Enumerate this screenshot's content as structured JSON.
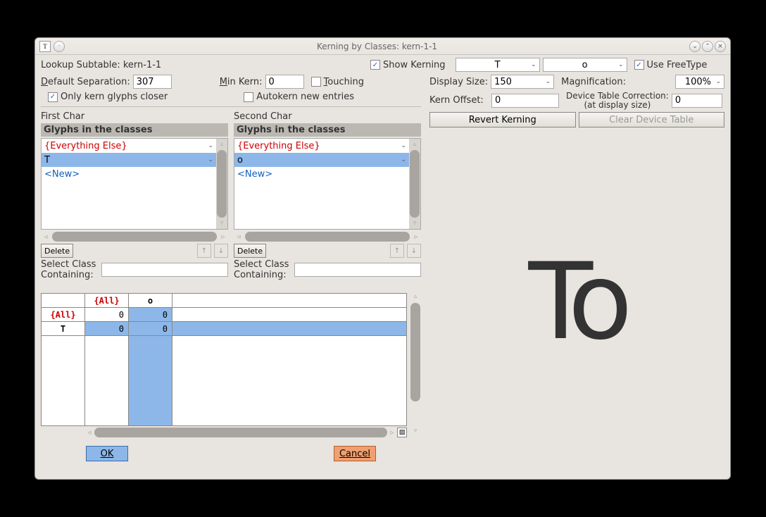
{
  "window": {
    "title": "Kerning by Classes: kern-1-1"
  },
  "top": {
    "lookup_label": "Lookup Subtable: kern-1-1",
    "show_kerning": "Show Kerning",
    "first_glyph": "T",
    "second_glyph": "o",
    "use_freetype": "Use FreeType",
    "default_sep_label": "efault Separation:",
    "default_sep_value": "307",
    "min_kern_label": "in Kern:",
    "min_kern_value": "0",
    "touching": "ouching",
    "only_kern_closer": "Only kern glyphs closer",
    "autokern": "Autokern new entries"
  },
  "right": {
    "display_size_label": "Display Size:",
    "display_size_value": "150",
    "magnification_label": "Magnification:",
    "magnification_value": "100%",
    "kern_offset_label": "Kern Offset:",
    "kern_offset_value": "0",
    "device_corr_label1": "Device Table Correction:",
    "device_corr_label2": "(at display size)",
    "device_corr_value": "0",
    "revert_btn": "Revert Kerning",
    "clear_btn": "Clear Device Table"
  },
  "panels": {
    "first_char": "First Char",
    "second_char": "Second Char",
    "glyphs_header": "Glyphs in the classes",
    "everything_else": "{Everything Else}",
    "new_item": "<New>",
    "first_selected": "T",
    "second_selected": "o",
    "delete_btn": "Delete",
    "select_class_label": "Select Class Containing:"
  },
  "table": {
    "col_all": "{All}",
    "col_o": "o",
    "row_all": "{All}",
    "row_T": "T",
    "v_all_all": "0",
    "v_all_o": "0",
    "v_T_all": "0",
    "v_T_o": "0"
  },
  "buttons": {
    "ok": "OK",
    "cancel": "Cancel"
  },
  "preview": {
    "text": "To"
  }
}
